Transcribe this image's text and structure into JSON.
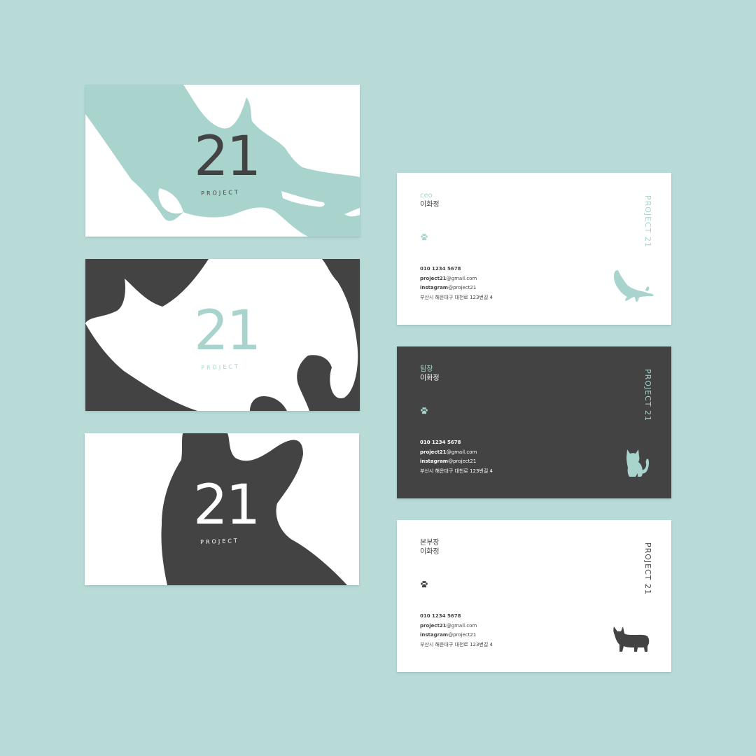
{
  "colors": {
    "background": "#b8dbd8",
    "mint": "#a9d4ce",
    "dark": "#434343",
    "white": "#ffffff"
  },
  "fronts": [
    {
      "number": "21",
      "label": "PROJECT",
      "theme": "white-card-mint-shape-dark-text"
    },
    {
      "number": "21",
      "label": "PROJECT",
      "theme": "dark-card-white-shape-mint-text"
    },
    {
      "number": "21",
      "label": "PROJECT",
      "theme": "white-card-dark-shape-white-text"
    }
  ],
  "backs": [
    {
      "role": "ceo",
      "name": "이화정",
      "phone": "010 1234 5678",
      "email_user": "project21",
      "email_domain": "@gmail.com",
      "instagram_label": "instagram",
      "instagram_handle": "@project21",
      "address": "부산시 해운대구 대천로 123번길 4",
      "brand": "PROJECT 21",
      "paw_icon": "paw-icon",
      "pet_icon": "stretching-cat-icon"
    },
    {
      "role": "팀장",
      "name": "이화정",
      "phone": "010 1234 5678",
      "email_user": "project21",
      "email_domain": "@gmail.com",
      "instagram_label": "instagram",
      "instagram_handle": "@project21",
      "address": "부산시 해운대구 대천로 123번길 4",
      "brand": "PROJECT 21",
      "paw_icon": "paw-icon",
      "pet_icon": "sitting-cat-icon"
    },
    {
      "role": "본부장",
      "name": "이화정",
      "phone": "010 1234 5678",
      "email_user": "project21",
      "email_domain": "@gmail.com",
      "instagram_label": "instagram",
      "instagram_handle": "@project21",
      "address": "부산시 해운대구 대천로 123번길 4",
      "brand": "PROJECT 21",
      "paw_icon": "paw-icon",
      "pet_icon": "corgi-dog-icon"
    }
  ]
}
